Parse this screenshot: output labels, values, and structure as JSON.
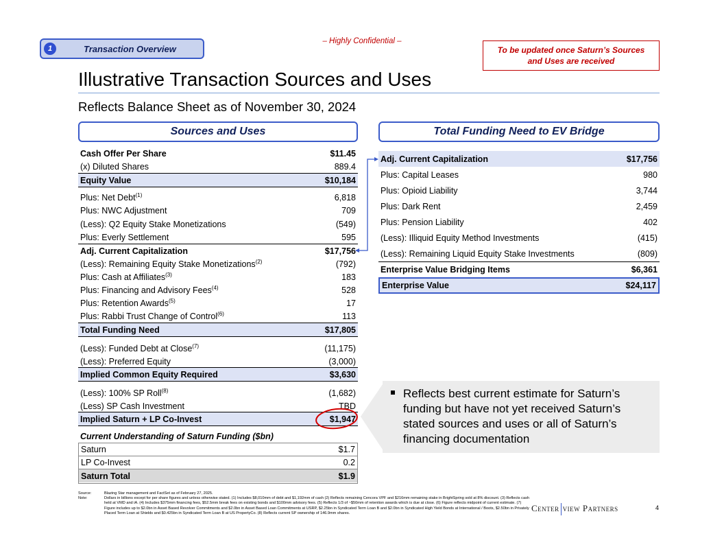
{
  "section": {
    "number": "1",
    "label": "Transaction Overview"
  },
  "confidential": "– Highly Confidential –",
  "update_note": {
    "line1": "To be updated once Saturn’s Sources",
    "line2": "and Uses are received"
  },
  "title": "Illustrative Transaction Sources and Uses",
  "subtitle": "Reflects Balance Sheet as of November 30, 2024",
  "sources_uses": {
    "header": "Sources and Uses",
    "rows": [
      {
        "label": "Cash Offer Per Share",
        "value": "$11.45"
      },
      {
        "label": "(x) Diluted Shares",
        "value": "889.4"
      },
      {
        "label": "Equity Value",
        "value": "$10,184"
      },
      {
        "label": "Plus: Net Debt",
        "note": "(1)",
        "value": "6,818"
      },
      {
        "label": "Plus: NWC Adjustment",
        "value": "709"
      },
      {
        "label": "(Less): Q2 Equity Stake Monetizations",
        "value": "(549)"
      },
      {
        "label": "Plus: Everly Settlement",
        "value": "595"
      },
      {
        "label": "Adj. Current Capitalization",
        "value": "$17,756"
      },
      {
        "label": "(Less): Remaining Equity Stake Monetizations",
        "note": "(2)",
        "value": "(792)"
      },
      {
        "label": "Plus: Cash at Affiliates",
        "note": "(3)",
        "value": "183"
      },
      {
        "label": "Plus: Financing and Advisory Fees",
        "note": "(4)",
        "value": "528"
      },
      {
        "label": "Plus: Retention Awards",
        "note": "(5)",
        "value": "17"
      },
      {
        "label": "Plus: Rabbi Trust Change of Control",
        "note": "(6)",
        "value": "113"
      },
      {
        "label": "Total Funding Need",
        "value": "$17,805"
      },
      {
        "label": "(Less): Funded Debt at Close",
        "note": "(7)",
        "value": "(11,175)"
      },
      {
        "label": "(Less): Preferred Equity",
        "value": "(3,000)"
      },
      {
        "label": "Implied Common Equity Required",
        "value": "$3,630"
      },
      {
        "label": "(Less): 100% SP Roll",
        "note": "(8)",
        "value": "(1,682)"
      },
      {
        "label": "(Less) SP Cash Investment",
        "value": "TBD"
      },
      {
        "label": "Implied Saturn + LP Co-Invest",
        "value": "$1,947"
      }
    ]
  },
  "saturn_funding": {
    "title": "Current Understanding of Saturn Funding ($bn)",
    "rows": [
      {
        "label": "Saturn",
        "value": "$1.7"
      },
      {
        "label": "LP Co-Invest",
        "value": "0.2"
      },
      {
        "label": "Saturn Total",
        "value": "$1.9"
      }
    ]
  },
  "ev_bridge": {
    "header": "Total Funding Need to EV Bridge",
    "rows": [
      {
        "label": "Adj. Current Capitalization",
        "value": "$17,756"
      },
      {
        "label": "Plus: Capital Leases",
        "value": "980"
      },
      {
        "label": "Plus: Opioid Liability",
        "value": "3,744"
      },
      {
        "label": "Plus: Dark Rent",
        "value": "2,459"
      },
      {
        "label": "Plus: Pension Liability",
        "value": "402"
      },
      {
        "label": "(Less): Illiquid Equity Method Investments",
        "value": "(415)"
      },
      {
        "label": "(Less): Remaining Liquid Equity Stake Investments",
        "value": "(809)"
      },
      {
        "label": "Enterprise Value Bridging Items",
        "value": "$6,361"
      },
      {
        "label": "Enterprise Value",
        "value": "$24,117"
      }
    ]
  },
  "callout": "Reflects best current estimate for Saturn’s funding but have not yet received Saturn’s stated sources and uses or all of Saturn’s financing documentation",
  "footnotes": {
    "source_key": "Source:",
    "source": "Blazing Star management and FactSet as of February 27, 2025.",
    "note_key": "Note:",
    "note": "Dollars in billions except for per share figures and unless otherwise stated. (1) Includes $8,010mm of debt and $1,192mm of cash (2) Reflects remaining Cencora VPF and $216mm remaining stake in BrightSpring sold at 8% discount. (3) Reflects cash held at VMD and iA. (4) Includes $375mm financing fees, $52.5mm break fees on existing bonds and $100mm advisory fees. (5) Reflects 1/3 of ~$50mm of retention awards which is due at close. (6) Figure reflects midpoint of current estimate. (7) Figure includes up to $2.0bn in Asset Based Revolver Commitments and $2.0bn in Asset Based Loan Commitments at USRP, $2.25bn in Syndicated Term Loan B and $2.0bn in Syndicated High Yield Bonds at International / Boots, $2.50bn in Privately Placed Term Loan at Shields and $0.425bn in Syndicated Term Loan B at US PropertyCo. (8) Reflects current SP ownership of 146.9mm shares."
  },
  "logo": {
    "left": "Center",
    "right": "view Partners"
  },
  "page_number": "4",
  "colors": {
    "accent": "#3b5bc9",
    "shade": "#dde3f5",
    "alert": "#c00000"
  }
}
